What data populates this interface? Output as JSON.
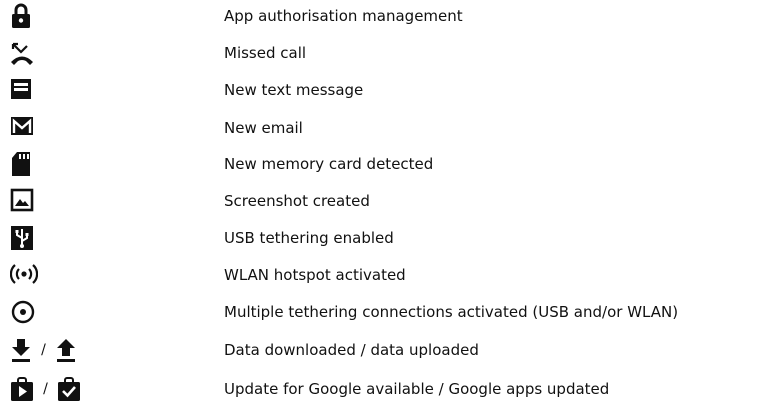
{
  "rows": [
    {
      "icon": "lock-icon",
      "text": "App authorisation management"
    },
    {
      "icon": "missed-call-icon",
      "text": "Missed call"
    },
    {
      "icon": "message-icon",
      "text": "New text message"
    },
    {
      "icon": "gmail-icon",
      "text": "New email"
    },
    {
      "icon": "sd-card-icon",
      "text": "New memory card detected"
    },
    {
      "icon": "screenshot-icon",
      "text": "Screenshot created"
    },
    {
      "icon": "usb-icon",
      "text": "USB tethering enabled"
    },
    {
      "icon": "hotspot-icon",
      "text": "WLAN hotspot activated"
    },
    {
      "icon": "tethering-icon",
      "text": "Multiple tethering connections activated (USB and/or WLAN)"
    },
    {
      "icons": [
        "download-icon",
        "upload-icon"
      ],
      "separator": "/",
      "text": "Data downloaded / data uploaded"
    },
    {
      "icons": [
        "google-play-update-icon",
        "google-apps-updated-icon"
      ],
      "separator": "/",
      "text": "Update for Google available / Google apps updated"
    }
  ]
}
